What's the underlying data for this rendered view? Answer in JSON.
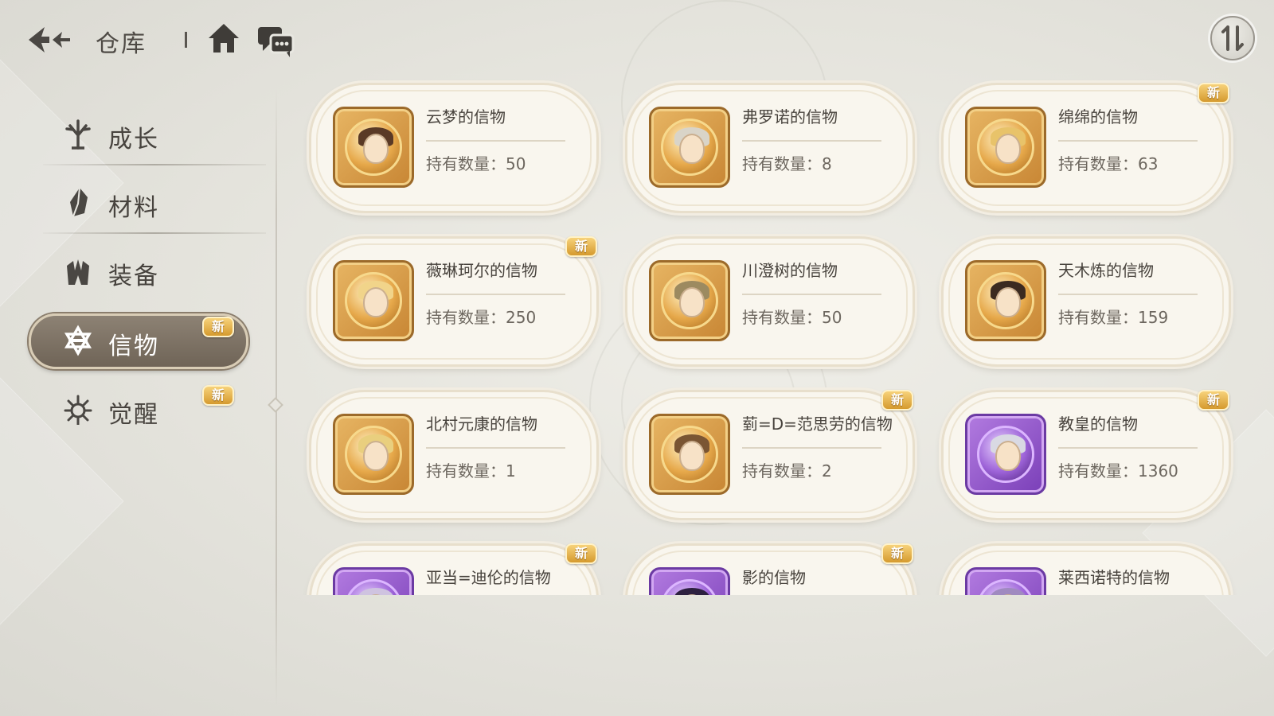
{
  "header": {
    "title": "仓库"
  },
  "sidebar": {
    "items": [
      {
        "label": "成长",
        "icon": "tree-icon",
        "new": false
      },
      {
        "label": "材料",
        "icon": "crystal-icon",
        "new": false
      },
      {
        "label": "装备",
        "icon": "armor-icon",
        "new": false
      },
      {
        "label": "信物",
        "icon": "star-emblem-icon",
        "new": true,
        "active": true
      },
      {
        "label": "觉醒",
        "icon": "burst-icon",
        "new": true
      }
    ],
    "new_badge": "新"
  },
  "count_prefix": "持有数量：",
  "cards": [
    {
      "name": "云梦的信物",
      "count": "50",
      "new": false,
      "tier": "gold",
      "hair": "#5a3a26"
    },
    {
      "name": "弗罗诺的信物",
      "count": "8",
      "new": false,
      "tier": "gold",
      "hair": "#d9d4c8"
    },
    {
      "name": "绵绵的信物",
      "count": "63",
      "new": true,
      "tier": "gold",
      "hair": "#e8c36a"
    },
    {
      "name": "薇琳珂尔的信物",
      "count": "250",
      "new": true,
      "tier": "gold",
      "hair": "#f1d48a"
    },
    {
      "name": "川澄树的信物",
      "count": "50",
      "new": false,
      "tier": "gold",
      "hair": "#9c8a60"
    },
    {
      "name": "天木炼的信物",
      "count": "159",
      "new": false,
      "tier": "gold",
      "hair": "#3b2a20"
    },
    {
      "name": "北村元康的信物",
      "count": "1",
      "new": false,
      "tier": "gold",
      "hair": "#e9cf7e"
    },
    {
      "name": "菿=D=范思劳的信物",
      "count": "2",
      "new": true,
      "tier": "gold",
      "hair": "#7a5533"
    },
    {
      "name": "教皇的信物",
      "count": "1360",
      "new": true,
      "tier": "purple",
      "hair": "#d9d9e3"
    },
    {
      "name": "亚当=迪伦的信物",
      "count": "",
      "new": true,
      "tier": "purple",
      "hair": "#cfc3e0"
    },
    {
      "name": "影的信物",
      "count": "",
      "new": true,
      "tier": "purple",
      "hair": "#2d2040"
    },
    {
      "name": "莱西诺特的信物",
      "count": "",
      "new": false,
      "tier": "purple",
      "hair": "#a08ac0"
    }
  ],
  "colors": {
    "accent_gold": "#d59a2e",
    "active_tab": "#7a6e60",
    "card_bg": "#f9f6ee"
  }
}
